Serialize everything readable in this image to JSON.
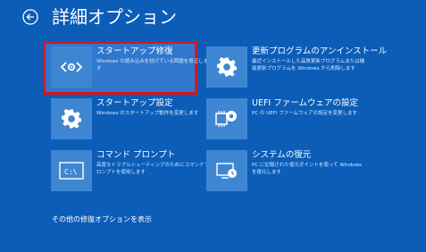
{
  "header": {
    "title": "詳細オプション"
  },
  "tiles": [
    {
      "title": "スタートアップ修復",
      "description": "Windows の読み込みを妨げている問題を修正します",
      "icon": "code-icon"
    },
    {
      "title": "更新プログラムのアンインストール",
      "description": "最近インストールした品質更新プログラムまたは機能更新プログラムを Windows から削除します",
      "icon": "gear-icon"
    },
    {
      "title": "スタートアップ設定",
      "description": "Windows のスタートアップ動作を変更します",
      "icon": "gear-icon"
    },
    {
      "title": "UEFI ファームウェアの設定",
      "description": "PC の UEFI ファームウェアの設定を変更します",
      "icon": "chip-gear-icon"
    },
    {
      "title": "コマンド プロンプト",
      "description": "高度なトラブルシューティングのためにコマンドプロンプトを使用します",
      "icon": "command-prompt-icon"
    },
    {
      "title": "システムの復元",
      "description": "PC に記録された復元ポイントを使って Windows を復元します",
      "icon": "restore-icon"
    }
  ],
  "footer": {
    "more_options": "その他の修復オプションを表示"
  },
  "colors": {
    "background": "#0b5db8",
    "tile_icon": "#3f86d2",
    "selected_border": "#d9161c"
  }
}
